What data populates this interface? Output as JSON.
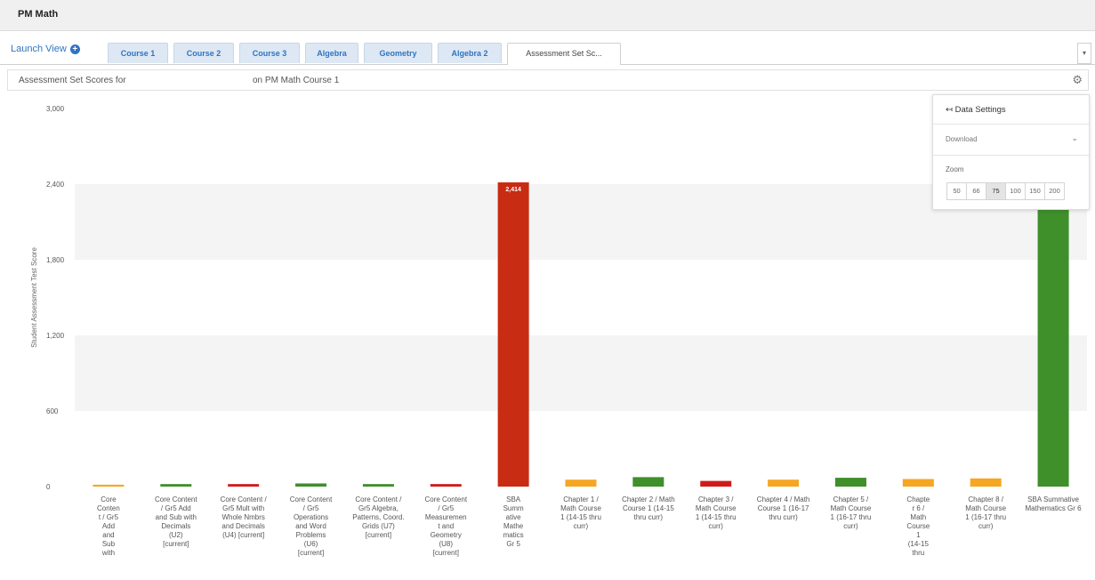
{
  "app": {
    "title": "PM Math"
  },
  "nav": {
    "launch_view": "Launch View",
    "tabs": [
      {
        "label": "Course 1"
      },
      {
        "label": "Course 2"
      },
      {
        "label": "Course 3"
      },
      {
        "label": "Algebra"
      },
      {
        "label": "Geometry"
      },
      {
        "label": "Algebra 2"
      },
      {
        "label": "Assessment Set Sc..."
      }
    ],
    "menu_glyph": "▾"
  },
  "header": {
    "title_left": "Assessment Set Scores for",
    "title_right": "on PM Math Course 1"
  },
  "settings": {
    "title": "Data Settings",
    "download": "Download",
    "zoom_label": "Zoom",
    "zoom_levels": [
      "50",
      "66",
      "75",
      "100",
      "150",
      "200"
    ],
    "zoom_selected": "75"
  },
  "chart_data": {
    "type": "bar",
    "title": "",
    "xlabel": "",
    "ylabel": "Student Assessment Test Score",
    "ylim": [
      0,
      3000
    ],
    "yticks": [
      "3,000",
      "2,400",
      "1,800",
      "1,200",
      "600",
      "0"
    ],
    "grid": "alternating bands",
    "categories": [
      "Core Conten t / Gr5 Add and Sub with",
      "Core Content / Gr5 Add and Sub with Decimals (U2) [current]",
      "Core Content / Gr5 Mult with Whole Nmbrs and Decimals (U4) [current]",
      "Core Content / Gr5 Operations and Word Problems (U6) [current]",
      "Core Content / Gr5 Algebra, Patterns, Coord. Grids (U7) [current]",
      "Core Content / Gr5 Measuremen t and Geometry (U8) [current]",
      "SBA Summ ative Mathe matics Gr 5",
      "Chapter 1 / Math Course 1 (14-15 thru curr)",
      "Chapter 2 / Math Course 1 (14-15 thru curr)",
      "Chapter 3 / Math Course 1 (14-15 thru curr)",
      "Chapter 4 / Math Course 1 (16-17 thru curr)",
      "Chapter 5 / Math Course 1 (16-17 thru curr)",
      "Chapte r 6 / Math Course 1 (14-15 thru",
      "Chapter 8 / Math Course 1 (16-17 thru curr)",
      "SBA Summative Mathematics Gr 6"
    ],
    "label_lines": [
      [
        "Core",
        "Conten",
        "t / Gr5",
        "Add",
        "and",
        "Sub",
        "with"
      ],
      [
        "Core Content",
        "/ Gr5 Add",
        "and Sub with",
        "Decimals",
        "(U2)",
        "[current]"
      ],
      [
        "Core Content /",
        "Gr5 Mult with",
        "Whole Nmbrs",
        "and Decimals",
        "(U4) [current]"
      ],
      [
        "Core Content",
        "/ Gr5",
        "Operations",
        "and Word",
        "Problems",
        "(U6)",
        "[current]"
      ],
      [
        "Core Content /",
        "Gr5 Algebra,",
        "Patterns, Coord.",
        "Grids (U7)",
        "[current]"
      ],
      [
        "Core Content",
        "/ Gr5",
        "Measuremen",
        "t and",
        "Geometry",
        "(U8)",
        "[current]"
      ],
      [
        "SBA",
        "Summ",
        "ative",
        "Mathe",
        "matics",
        "Gr 5"
      ],
      [
        "Chapter 1 /",
        "Math Course",
        "1 (14-15 thru",
        "curr)"
      ],
      [
        "Chapter 2 / Math",
        "Course 1 (14-15",
        "thru curr)"
      ],
      [
        "Chapter 3 /",
        "Math Course",
        "1 (14-15 thru",
        "curr)"
      ],
      [
        "Chapter 4 / Math",
        "Course 1 (16-17",
        "thru curr)"
      ],
      [
        "Chapter 5 /",
        "Math Course",
        "1 (16-17 thru",
        "curr)"
      ],
      [
        "Chapte",
        "r 6 /",
        "Math",
        "Course",
        "1",
        "(14-15",
        "thru"
      ],
      [
        "Chapter 8 /",
        "Math Course",
        "1 (16-17 thru",
        "curr)"
      ],
      [
        "SBA Summative",
        "Mathematics Gr 6"
      ]
    ],
    "values": [
      15,
      20,
      20,
      25,
      20,
      20,
      2414,
      55,
      75,
      45,
      55,
      70,
      60,
      65,
      2400
    ],
    "colors": [
      "#f5a623",
      "#3f8f2a",
      "#d11b1b",
      "#3f8f2a",
      "#3f8f2a",
      "#d11b1b",
      "#c82c12",
      "#f5a623",
      "#3f8f2a",
      "#d11b1b",
      "#f5a623",
      "#3f8f2a",
      "#f5a623",
      "#f5a623",
      "#3f8f2a"
    ],
    "data_labels": [
      "",
      "",
      "",
      "",
      "",
      "",
      "2,414",
      "",
      "",
      "",
      "",
      "",
      "",
      "",
      ""
    ]
  }
}
